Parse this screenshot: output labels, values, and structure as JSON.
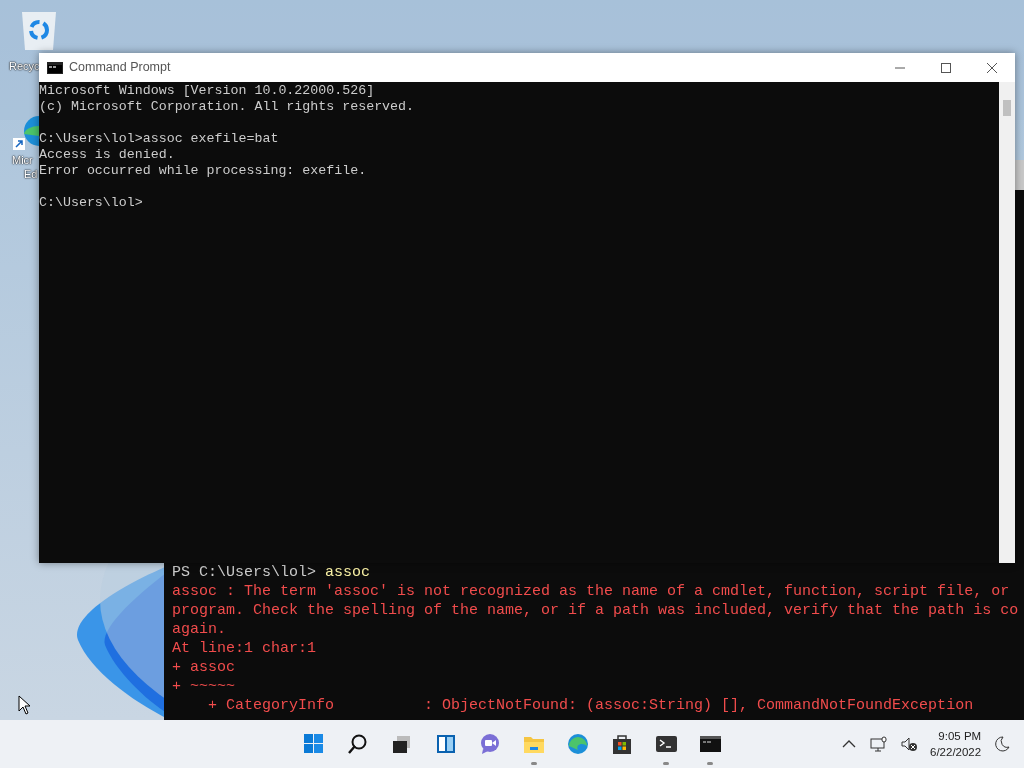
{
  "desktop_icons": [
    {
      "kind": "recycle-bin",
      "label_lines": [
        "Recyc"
      ]
    },
    {
      "kind": "edge",
      "label_lines": [
        "Micr",
        "Ed"
      ]
    }
  ],
  "powershell_window": {
    "lines": [
      {
        "kind": "prompt",
        "text": "PS C:\\Users\\lol> ",
        "command": "assoc"
      },
      {
        "kind": "error",
        "text": "assoc : The term 'assoc' is not recognized as the name of a cmdlet, function, script file, or"
      },
      {
        "kind": "error",
        "text": "program. Check the spelling of the name, or if a path was included, verify that the path is co"
      },
      {
        "kind": "error",
        "text": "again."
      },
      {
        "kind": "error",
        "text": "At line:1 char:1"
      },
      {
        "kind": "error",
        "text": "+ assoc"
      },
      {
        "kind": "error",
        "text": "+ ~~~~~"
      },
      {
        "kind": "error",
        "text": "    + CategoryInfo          : ObjectNotFound: (assoc:String) [], CommandNotFoundException"
      }
    ]
  },
  "cmd_window": {
    "title": "Command Prompt",
    "blocks": [
      [
        "Microsoft Windows [Version 10.0.22000.526]",
        "(c) Microsoft Corporation. All rights reserved."
      ],
      [
        "C:\\Users\\lol>assoc exefile=bat",
        "Access is denied.",
        "Error occurred while processing: exefile."
      ],
      [
        "C:\\Users\\lol>"
      ]
    ]
  },
  "taskbar": {
    "apps": [
      {
        "kind": "start",
        "running": false
      },
      {
        "kind": "search",
        "running": false
      },
      {
        "kind": "task-view",
        "running": false
      },
      {
        "kind": "widgets",
        "running": false
      },
      {
        "kind": "chat",
        "running": false
      },
      {
        "kind": "explorer",
        "running": true
      },
      {
        "kind": "edge",
        "running": false
      },
      {
        "kind": "store",
        "running": false
      },
      {
        "kind": "terminal",
        "running": true
      },
      {
        "kind": "cmd",
        "running": true
      }
    ],
    "time": "9:05 PM",
    "date": "6/22/2022"
  }
}
